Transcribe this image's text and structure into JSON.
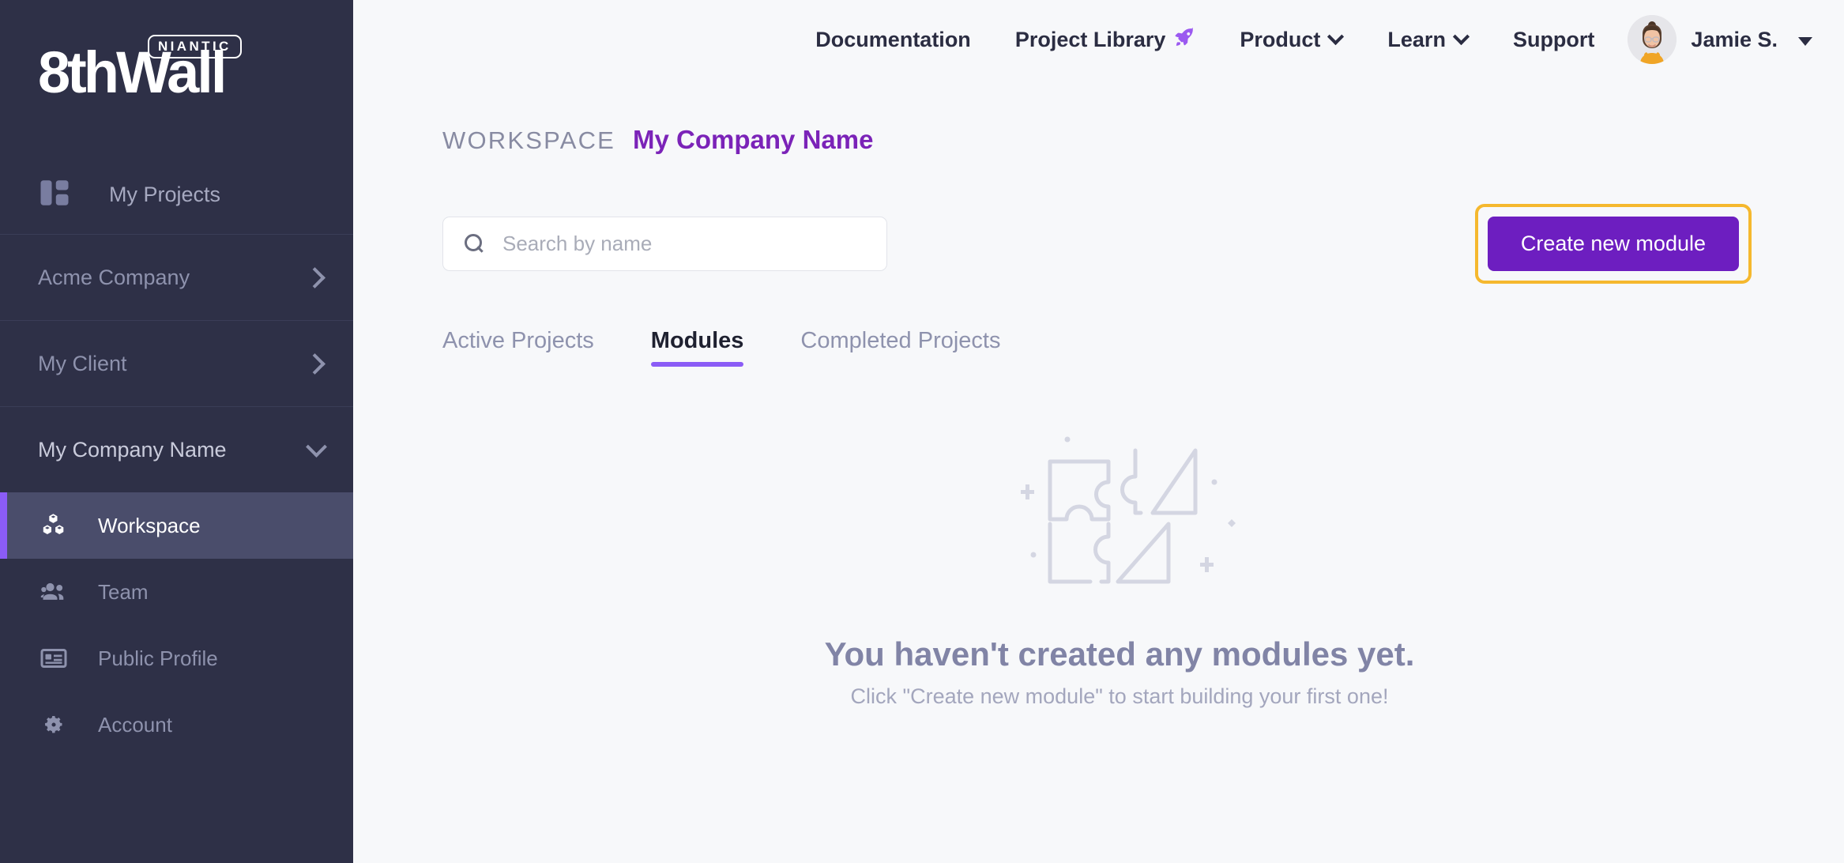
{
  "brand": {
    "badge": "NIANTIC",
    "logo_eight": "8th",
    "logo_wall": "Wall"
  },
  "sidebar": {
    "my_projects": {
      "label": "My Projects",
      "icon": "grid-icon"
    },
    "workspaces": [
      {
        "label": "Acme Company",
        "expanded": false,
        "icon": "chevron-right-icon"
      },
      {
        "label": "My Client",
        "expanded": false,
        "icon": "chevron-right-icon"
      },
      {
        "label": "My Company Name",
        "expanded": true,
        "icon": "chevron-down-icon"
      }
    ],
    "sub_items": [
      {
        "label": "Workspace",
        "icon": "cubes-icon",
        "active": true
      },
      {
        "label": "Team",
        "icon": "people-icon",
        "active": false
      },
      {
        "label": "Public Profile",
        "icon": "id-card-icon",
        "active": false
      },
      {
        "label": "Account",
        "icon": "gear-icon",
        "active": false
      }
    ]
  },
  "topnav": {
    "documentation": "Documentation",
    "project_library": "Project Library",
    "project_library_icon": "rocket-icon",
    "product": "Product",
    "learn": "Learn",
    "support": "Support",
    "user_name": "Jamie S.",
    "avatar_icon": "user-avatar"
  },
  "header": {
    "kicker": "WORKSPACE",
    "workspace_name": "My Company Name"
  },
  "search": {
    "placeholder": "Search by name",
    "value": "",
    "icon": "search-icon"
  },
  "cta": {
    "label": "Create new module",
    "highlight_color": "#f5b82e",
    "button_color": "#6d1ec0"
  },
  "tabs": [
    {
      "label": "Active Projects",
      "active": false
    },
    {
      "label": "Modules",
      "active": true
    },
    {
      "label": "Completed Projects",
      "active": false
    }
  ],
  "empty_state": {
    "illustration_icon": "puzzle-pieces-icon",
    "title": "You haven't created any modules yet.",
    "subtitle": "Click \"Create new module\" to start building your first one!"
  },
  "colors": {
    "sidebar_bg": "#2e3047",
    "accent_purple": "#8b5cf6",
    "brand_purple": "#7b23b8",
    "highlight_yellow": "#f5b82e"
  }
}
